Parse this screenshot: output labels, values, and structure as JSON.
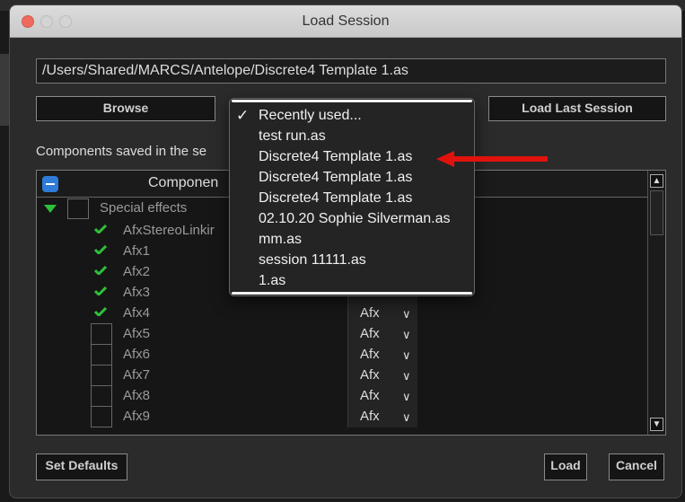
{
  "window": {
    "title": "Load Session"
  },
  "path": {
    "value": "/Users/Shared/MARCS/Antelope/Discrete4 Template 1.as"
  },
  "buttons": {
    "browse": "Browse",
    "load_last": "Load Last Session",
    "set_defaults": "Set Defaults",
    "load": "Load",
    "cancel": "Cancel"
  },
  "components_label": "Components saved in the se",
  "table": {
    "header_label": "Componen",
    "group": {
      "label": "Special effects"
    },
    "rows": [
      {
        "label": "AfxStereoLinkir",
        "checked": true,
        "value": ""
      },
      {
        "label": "Afx1",
        "checked": true,
        "value": ""
      },
      {
        "label": "Afx2",
        "checked": true,
        "value": ""
      },
      {
        "label": "Afx3",
        "checked": true,
        "value": ""
      },
      {
        "label": "Afx4",
        "checked": true,
        "value": "Afx"
      },
      {
        "label": "Afx5",
        "checked": false,
        "value": "Afx"
      },
      {
        "label": "Afx6",
        "checked": false,
        "value": "Afx"
      },
      {
        "label": "Afx7",
        "checked": false,
        "value": "Afx"
      },
      {
        "label": "Afx8",
        "checked": false,
        "value": "Afx"
      },
      {
        "label": "Afx9",
        "checked": false,
        "value": "Afx"
      }
    ]
  },
  "dropdown": {
    "items": [
      {
        "label": "Recently used...",
        "selected": true
      },
      {
        "label": "test run.as",
        "selected": false
      },
      {
        "label": "Discrete4 Template 1.as",
        "selected": false
      },
      {
        "label": "Discrete4 Template 1.as",
        "selected": false
      },
      {
        "label": "Discrete4 Template 1.as",
        "selected": false
      },
      {
        "label": "02.10.20 Sophie Silverman.as",
        "selected": false
      },
      {
        "label": "mm.as",
        "selected": false
      },
      {
        "label": "session 11111.as",
        "selected": false
      },
      {
        "label": "1.as",
        "selected": false
      }
    ]
  },
  "icons": {
    "check": "checkmark-icon",
    "expand": "triangle-down-icon",
    "chevron": "chevron-down-icon",
    "annotation": "red-arrow-icon"
  },
  "colors": {
    "accent_blue": "#2e7bd8",
    "check_green": "#2fbf3a",
    "arrow_red": "#e0120c",
    "close_red": "#ee6a5f"
  }
}
